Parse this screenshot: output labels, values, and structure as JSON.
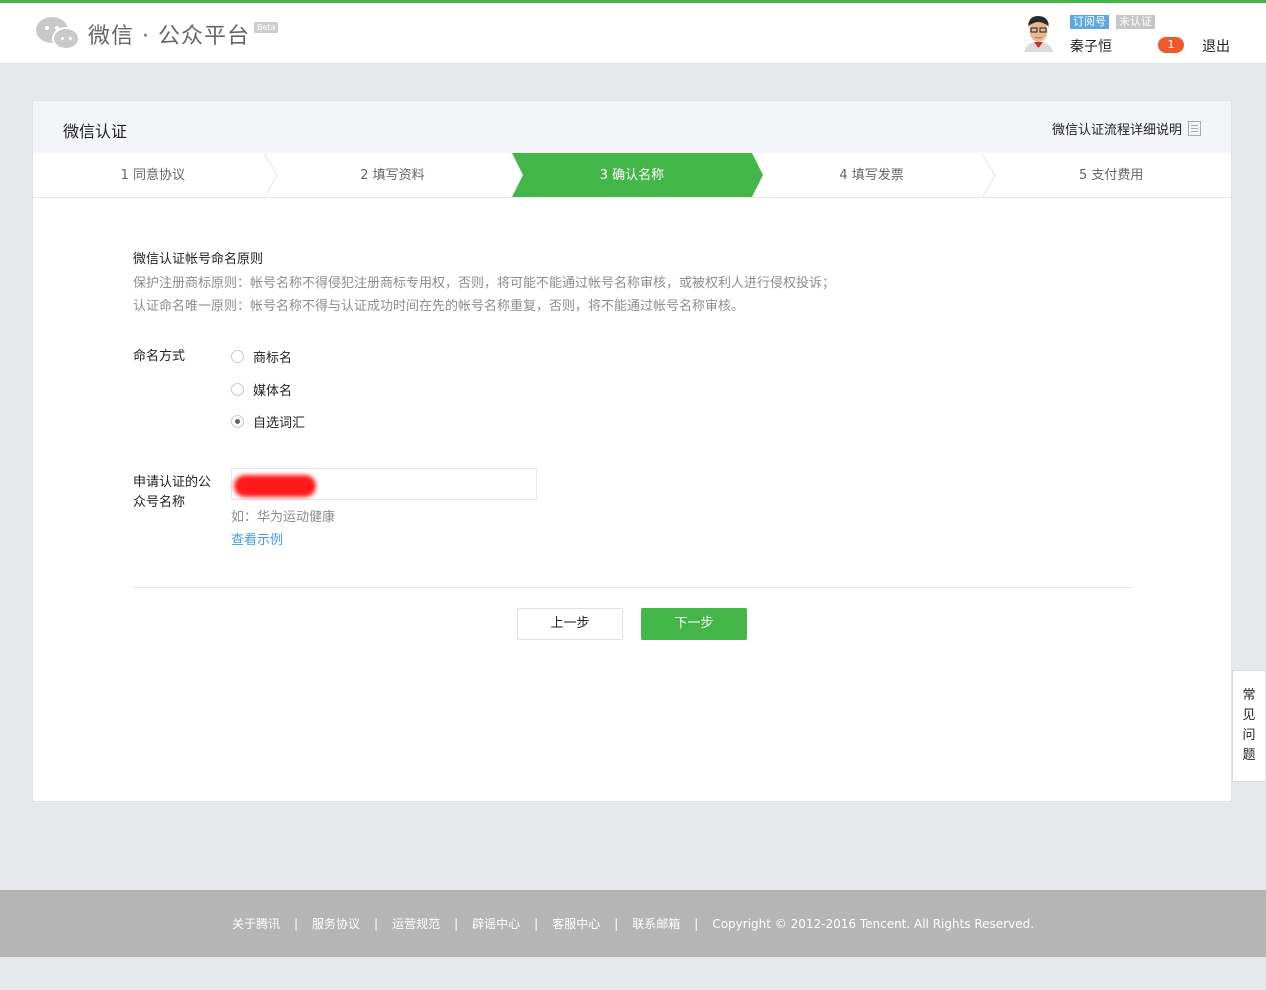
{
  "header": {
    "logo_text": "微信 · 公众平台",
    "beta": "Beta",
    "account_type": "订阅号",
    "verify_status": "未认证",
    "username": "秦子恒",
    "notice_count": "1",
    "logout": "退出"
  },
  "panel": {
    "title": "微信认证",
    "help_link": "微信认证流程详细说明",
    "steps": [
      {
        "label": "1 同意协议"
      },
      {
        "label": "2 填写资料"
      },
      {
        "label": "3 确认名称"
      },
      {
        "label": "4 填写发票"
      },
      {
        "label": "5 支付费用"
      }
    ],
    "active_step": 3,
    "rules": {
      "title": "微信认证帐号命名原则",
      "line1": "保护注册商标原则：帐号名称不得侵犯注册商标专用权，否则，将可能不能通过帐号名称审核，或被权利人进行侵权投诉；",
      "line2": "认证命名唯一原则：帐号名称不得与认证成功时间在先的帐号名称重复，否则，将不能通过帐号名称审核。"
    },
    "naming": {
      "label": "命名方式",
      "options": [
        {
          "label": "商标名",
          "checked": false
        },
        {
          "label": "媒体名",
          "checked": false
        },
        {
          "label": "自选词汇",
          "checked": true
        }
      ]
    },
    "name_field": {
      "label_line1": "申请认证的公",
      "label_line2": "众号名称",
      "hint": "如：华为运动健康",
      "example_link": "查看示例"
    },
    "buttons": {
      "prev": "上一步",
      "next": "下一步"
    }
  },
  "faq_tab": [
    "常",
    "见",
    "问",
    "题"
  ],
  "footer": {
    "links": [
      "关于腾讯",
      "服务协议",
      "运营规范",
      "辟谣中心",
      "客服中心",
      "联系邮箱"
    ],
    "copyright": "Copyright © 2012-2016 Tencent. All Rights Reserved."
  },
  "colors": {
    "brand_green": "#44b549",
    "link_blue": "#459ae9",
    "badge_orange": "#f05a2b"
  }
}
